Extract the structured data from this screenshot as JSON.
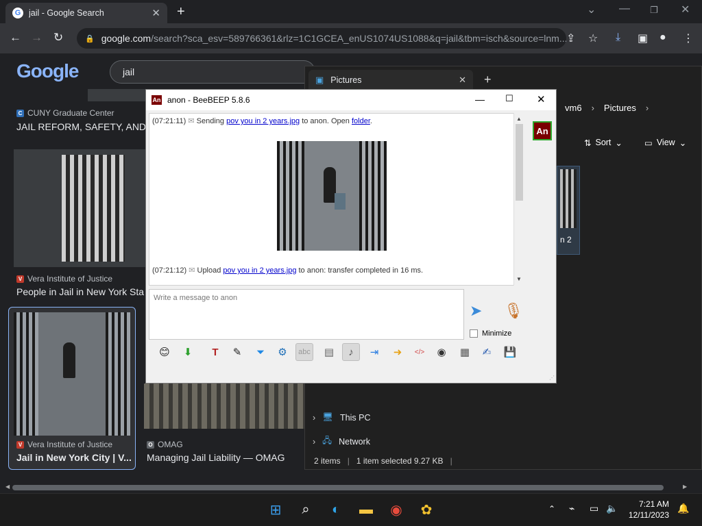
{
  "browser": {
    "tab_title": "jail - Google Search",
    "url_host": "google.com",
    "url_rest": "/search?sca_esv=589766361&rlz=1C1GCEA_enUS1074US1088&q=jail&tbm=isch&source=lnm...",
    "search_query": "jail",
    "logo": "Google"
  },
  "results": [
    {
      "source": "CUNY Graduate Center",
      "title": "JAIL REFORM, SAFETY, AND J"
    },
    {
      "source": "Vera Institute of Justice",
      "title": "People in Jail in New York Sta"
    },
    {
      "source": "Vera Institute of Justice",
      "title": "Jail in New York City | V..."
    },
    {
      "source": "OMAG",
      "title": "Managing Jail Liability — OMAG"
    }
  ],
  "explorer": {
    "tab_title": "Pictures",
    "crumb_1": "vm6",
    "crumb_2": "Pictures",
    "sort_label": "Sort",
    "view_label": "View",
    "thumb_caption": "n 2",
    "nav_this_pc": "This PC",
    "nav_network": "Network",
    "status_items": "2 items",
    "status_selected": "1 item selected  9.27 KB"
  },
  "beebeep": {
    "window_title": "anon - BeeBEEP 5.8.6",
    "user_badge": "An",
    "log_line1_time": "(07:21:11)",
    "log_line1_pre": "Sending",
    "log_line1_file": "pov you in 2 years.jpg",
    "log_line1_mid": "to anon. Open",
    "log_line1_link": "folder",
    "log_line1_end": ".",
    "log_line2_time": "(07:21:12)",
    "log_line2_pre": "Upload",
    "log_line2_file": "pov you in 2 years.jpg",
    "log_line2_end": "to anon: transfer completed in 16 ms.",
    "message_placeholder": "Write a message to anon",
    "minimize_label": "Minimize"
  },
  "taskbar": {
    "time": "7:21 AM",
    "date": "12/11/2023"
  }
}
